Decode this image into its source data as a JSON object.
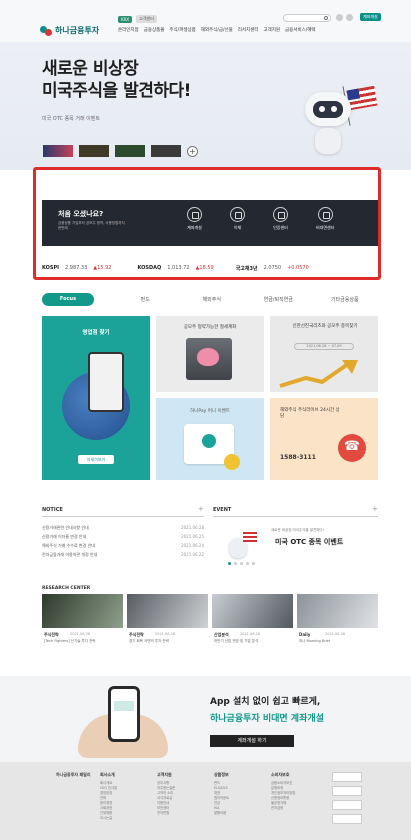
{
  "header": {
    "logo_text": "하나금융투자",
    "util_chips": [
      "KRX",
      "고객센터"
    ],
    "gnb": [
      "온라인지점",
      "금융상품몰",
      "주식/파생상품",
      "해외주식/금/선물",
      "리서치센터",
      "고객지원",
      "금융서비스/혜택"
    ],
    "top_button": "계좌개설"
  },
  "hero": {
    "title": "새로운 비상장\n미국주식을 발견하다!",
    "subtitle": "미국 OTC 종목 거래 이벤트",
    "plus": "+"
  },
  "quick_menu": {
    "title": "처음 오셨나요?",
    "subtitle": "금융상품 가입부터 공모주 청약, 사용방법까지 한번에",
    "items": [
      {
        "label": "계좌개설",
        "icon": "account-icon"
      },
      {
        "label": "이체",
        "icon": "transfer-icon"
      },
      {
        "label": "인증센터",
        "icon": "certificate-icon"
      },
      {
        "label": "비대면센터",
        "icon": "remote-center-icon"
      }
    ]
  },
  "ticker": [
    {
      "name": "KOSPI",
      "value": "2,987.33",
      "change": "▲15.92"
    },
    {
      "name": "KOSDAQ",
      "value": "1,013.72",
      "change": "▲18.59"
    },
    {
      "name": "국고채3년",
      "value": "2.0750",
      "change": "+0.0570"
    }
  ],
  "tabs": [
    "Focus",
    "펀드",
    "해외주식",
    "연금/퇴직연금",
    "기타금융상품"
  ],
  "promo": {
    "teal_title": "영업점 찾기",
    "teal_button": "자세히보기",
    "gray1_title": "공모주 청약가능한 절세계좌",
    "gray2_title": "신한선진국리츠와 공모주 종목찾기",
    "gray2_tag": "2021.06.28 ~ 07.09",
    "blue_title": "하나Pay 머니 이벤트",
    "orange_title": "해외주식 주식라이브 24시간 상담",
    "orange_number": "1588-3111"
  },
  "notice": {
    "head": "NOTICE",
    "items": [
      {
        "title": "신용거래관련 안내사항 안내",
        "date": "2021.06.28"
      },
      {
        "title": "신용거래 이자율 변경 안내",
        "date": "2021.06.25"
      },
      {
        "title": "해외주식 거래 수수료 변경 안내",
        "date": "2021.06.24"
      },
      {
        "title": "전자금융거래 이용약관 개정 안내",
        "date": "2021.06.22"
      }
    ]
  },
  "event": {
    "head": "EVENT",
    "subtitle": "새로운 비상장 미국주식을 발견하다!",
    "title": "미국 OTC 종목 이벤트"
  },
  "research": {
    "head": "RESEARCH CENTER",
    "items": [
      {
        "category": "주식전략",
        "date": "2021.06.28",
        "title": "[Tech Fighters] 신기술 투자 전략"
      },
      {
        "category": "주식전략",
        "date": "2021.06.28",
        "title": "경기 회복 국면의 투자 전략"
      },
      {
        "category": "산업분석",
        "date": "2021.06.28",
        "title": "하반기 산업 전망 및 기업 분석"
      },
      {
        "category": "Daily",
        "date": "2021.06.28",
        "title": "하나 Morning Brief"
      }
    ]
  },
  "app_banner": {
    "title1": "App 설치 없이 쉽고 빠르게,",
    "title2": "하나금융투자 비대면 계좌개설",
    "button": "계좌개설 하기"
  },
  "footer": {
    "brand": "하나금융투자 패밀리",
    "columns": [
      {
        "title": "회사소개",
        "items": [
          "회사개요",
          "CEO 인사말",
          "경영방침",
          "연혁",
          "윤리경영",
          "사회공헌",
          "인재채용",
          "오시는길"
        ]
      },
      {
        "title": "고객지원",
        "items": [
          "공지사항",
          "자주묻는질문",
          "고객의 소리",
          "서식자료실",
          "이용안내",
          "보안센터",
          "전자민원"
        ]
      },
      {
        "title": "상품정보",
        "items": [
          "펀드",
          "ELS/DLS",
          "채권",
          "랩어카운트",
          "연금",
          "ISA",
          "발행어음"
        ]
      },
      {
        "title": "소비자보호",
        "items": [
          "금융소비자보호",
          "분쟁조정",
          "개인정보처리방침",
          "신용정보활용",
          "불공정거래",
          "전자금융"
        ]
      }
    ]
  }
}
